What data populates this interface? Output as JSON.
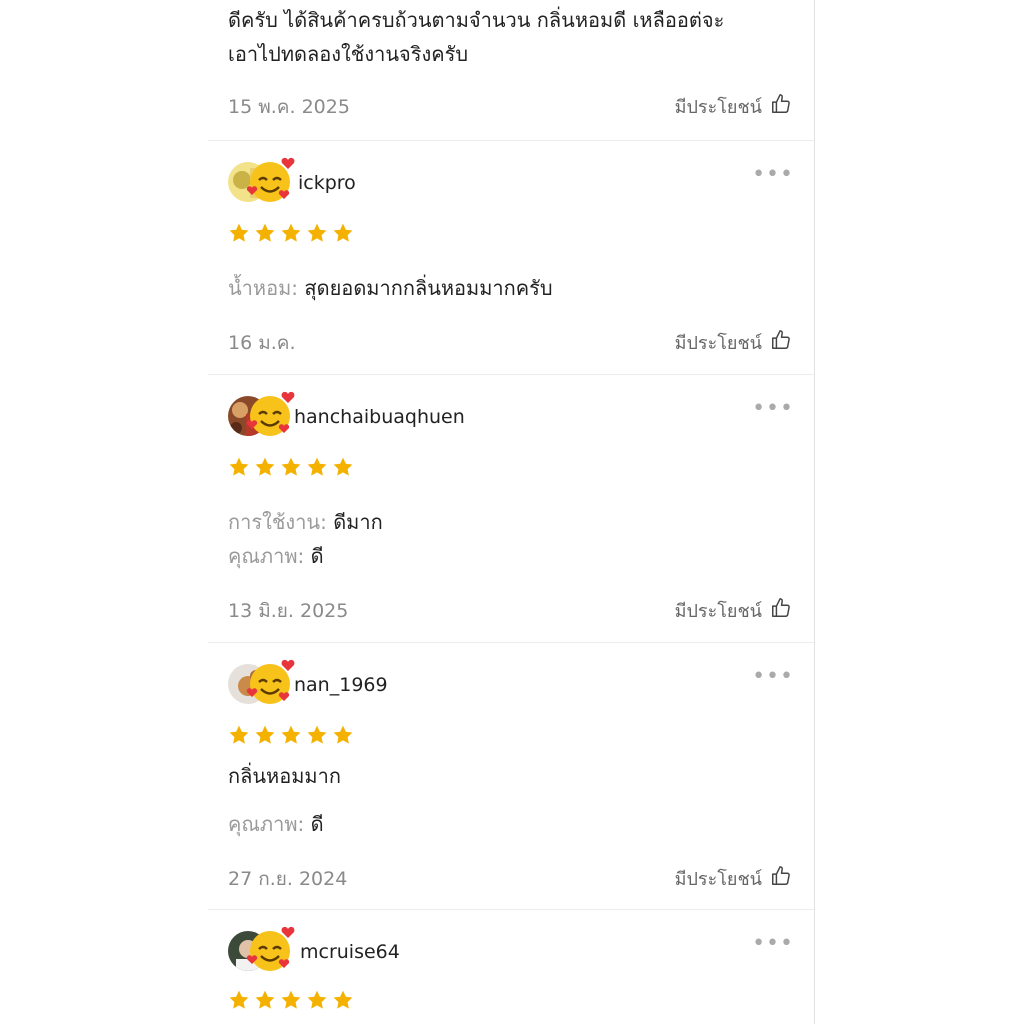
{
  "top_review": {
    "text_line1": "ดีครับ ได้สินค้าครบถ้วนตามจำนวน กลิ่นหอมดี เหลืออต่จะ",
    "text_line2": "เอาไปทดลองใช้งานจริงครับ",
    "date": "15 พ.ค. 2025",
    "helpful_label": "มีประโยชน์"
  },
  "reviews": [
    {
      "username": "ickpro",
      "rating": 5,
      "attr1_label": "น้ำหอม:",
      "attr1_value": "สุดยอดมากกลิ่นหอมมากครับ",
      "date": "16 ม.ค.",
      "helpful_label": "มีประโยชน์"
    },
    {
      "username": "hanchaibuaqhuen",
      "rating": 5,
      "attr1_label": "การใช้งาน:",
      "attr1_value": "ดีมาก",
      "attr2_label": "คุณภาพ:",
      "attr2_value": "ดี",
      "date": "13 มิ.ย. 2025",
      "helpful_label": "มีประโยชน์"
    },
    {
      "username": "nan_1969",
      "rating": 5,
      "comment": "กลิ่นหอมมาก",
      "attr1_label": "คุณภาพ:",
      "attr1_value": "ดี",
      "date": "27 ก.ย. 2024",
      "helpful_label": "มีประโยชน์"
    },
    {
      "username": "mcruise64",
      "rating": 5
    }
  ],
  "more_glyph": "•••",
  "colors": {
    "star": "#f5b100",
    "divider": "#ececec",
    "label": "#9a9a9a"
  },
  "icons": {
    "helpful": "thumbs-up-icon",
    "more": "more-options-icon",
    "star": "star-icon",
    "sticker": "smiling-face-with-hearts-icon"
  }
}
